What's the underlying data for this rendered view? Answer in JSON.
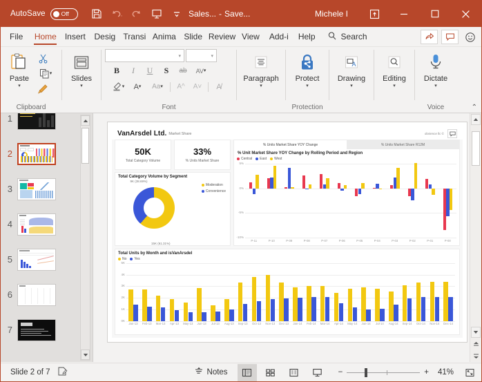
{
  "titlebar": {
    "autosave_label": "AutoSave",
    "autosave_state": "Off",
    "doc_name": "Sales...",
    "doc_sep": "-",
    "doc_saved": "Save...",
    "user": "Michele I",
    "qat": [
      "save-icon",
      "undo-icon",
      "redo-icon",
      "start-presentation-icon",
      "customize-qat-icon"
    ],
    "window_buttons": [
      "ribbon-display-options",
      "minimize",
      "maximize",
      "close"
    ],
    "bg_color": "#b7472a"
  },
  "tabs": {
    "items": [
      {
        "label": "File",
        "active": false
      },
      {
        "label": "Home",
        "active": true
      },
      {
        "label": "Insert",
        "active": false
      },
      {
        "label": "Desig",
        "active": false
      },
      {
        "label": "Transi",
        "active": false
      },
      {
        "label": "Anima",
        "active": false
      },
      {
        "label": "Slide ",
        "active": false
      },
      {
        "label": "Review",
        "active": false
      },
      {
        "label": "View",
        "active": false
      },
      {
        "label": "Add-i",
        "active": false
      },
      {
        "label": "Help",
        "active": false
      }
    ],
    "search_label": "Search",
    "right_buttons": [
      "share-icon",
      "comments-icon",
      "feedback-smiley-icon"
    ]
  },
  "ribbon": {
    "groups": [
      {
        "name": "Clipboard",
        "label": "Clipboard"
      },
      {
        "name": "Slides",
        "label": ""
      },
      {
        "name": "Font",
        "label": "Font"
      },
      {
        "name": "Paragraph",
        "label": ""
      },
      {
        "name": "Protection",
        "label": "Protection"
      },
      {
        "name": "Drawing",
        "label": ""
      },
      {
        "name": "Editing",
        "label": ""
      },
      {
        "name": "Voice",
        "label": "Voice"
      }
    ],
    "paste_label": "Paste",
    "slides_label": "Slides",
    "paragraph_label": "Paragraph",
    "protect_label": "Protect",
    "drawing_label": "Drawing",
    "editing_label": "Editing",
    "dictate_label": "Dictate",
    "font_name_value": "",
    "font_name_placeholder": "",
    "font_size_value": "",
    "font_buttons": [
      "bold",
      "italic",
      "underline",
      "text-shadow",
      "strikethrough",
      "character-spacing"
    ],
    "font_buttons_row2": [
      "text-highlight",
      "font-color",
      "change-case",
      "increase-font-size",
      "decrease-font-size",
      "clear-formatting"
    ]
  },
  "thumbnails": {
    "slides": [
      {
        "num": "1",
        "selected": false
      },
      {
        "num": "2",
        "selected": true
      },
      {
        "num": "3",
        "selected": false
      },
      {
        "num": "4",
        "selected": false
      },
      {
        "num": "5",
        "selected": false
      },
      {
        "num": "6",
        "selected": false
      },
      {
        "num": "7",
        "selected": false
      }
    ]
  },
  "slide": {
    "dashboard_title": "VanArsdel Ltd.",
    "dashboard_subtitle": "Market Share",
    "credit": "obvience llc ©",
    "kpis": [
      {
        "value": "50K",
        "label": "Total Category Volume"
      },
      {
        "value": "33%",
        "label": "% Units Market Share"
      }
    ],
    "donut_panel_title": "Total Category Volume by Segment",
    "subtabs": [
      {
        "label": "% Units Market Share YOY Change",
        "active": true
      },
      {
        "label": "% Units Market Share R12M",
        "active": false
      }
    ],
    "yoy_chart_title": "% Unit Market Share YOY Change by Rolling Period and Region",
    "bottom_panel_title": "Total Units by Month and isVanArsdel"
  },
  "chart_data": [
    {
      "type": "pie",
      "title": "Total Category Volume by Segment",
      "labels": [
        "Moderation",
        "Convenience"
      ],
      "values": [
        61.31,
        38.69
      ],
      "data_labels": [
        "15K (61.31%)",
        "9K (38.69%)"
      ],
      "colors": [
        "#f2c811",
        "#3a57d8"
      ],
      "legend": "right"
    },
    {
      "type": "bar",
      "title": "% Unit Market Share YOY Change by Rolling Period and Region",
      "xlabel": "",
      "ylabel": "",
      "ylim": [
        -10,
        5
      ],
      "ytick_labels": [
        "5%",
        "0%",
        "-5%",
        "-10%"
      ],
      "ytick_values": [
        5,
        0,
        -5,
        -10
      ],
      "grid": true,
      "legend": "top",
      "categories": [
        "P-11",
        "P-10",
        "P-09",
        "P-08",
        "P-07",
        "P-06",
        "P-05",
        "P-04",
        "P-03",
        "P-02",
        "P-01",
        "P-00"
      ],
      "series": [
        {
          "name": "Central",
          "color": "#e8384f",
          "values": [
            1.2,
            2.1,
            0.2,
            2.6,
            2.9,
            1.1,
            -1.6,
            0.05,
            0.6,
            -1.6,
            1.9,
            -8.4
          ]
        },
        {
          "name": "East",
          "color": "#3a57d8",
          "values": [
            -1.2,
            2.2,
            4.2,
            -0.1,
            0.8,
            -0.4,
            -1.1,
            0.9,
            2.2,
            -2.4,
            0.8,
            -5.6
          ]
        },
        {
          "name": "West",
          "color": "#f2c811",
          "values": [
            2.7,
            4.6,
            0.2,
            0.8,
            2.1,
            0.6,
            1.1,
            -0.1,
            4.1,
            5.2,
            -1.3,
            -4.4
          ]
        }
      ]
    },
    {
      "type": "bar",
      "title": "Total Units by Month and isVanArsdel",
      "xlabel": "",
      "ylabel": "",
      "ylim": [
        0,
        5
      ],
      "ytick_labels": [
        "5K",
        "4K",
        "3K",
        "2K",
        "1K",
        "0K"
      ],
      "ytick_values": [
        5,
        4,
        3,
        2,
        1,
        0
      ],
      "grid": true,
      "legend": "top",
      "categories": [
        "Jan-13",
        "Feb-13",
        "Mar-13",
        "Apr-13",
        "May-13",
        "Jun-13",
        "Jul-13",
        "Aug-13",
        "Sep-13",
        "Oct-13",
        "Nov-13",
        "Dec-13",
        "Jan-14",
        "Feb-14",
        "Mar-14",
        "Apr-14",
        "May-14",
        "Jun-14",
        "Jul-14",
        "Aug-14",
        "Sep-14",
        "Oct-14",
        "Nov-14",
        "Dec-14"
      ],
      "series": [
        {
          "name": "No",
          "color": "#f2c811",
          "values": [
            2.75,
            2.75,
            2.2,
            1.9,
            1.6,
            2.85,
            1.35,
            1.9,
            3.35,
            3.8,
            4.0,
            3.35,
            2.9,
            3.0,
            3.0,
            2.45,
            2.8,
            2.9,
            2.8,
            2.55,
            3.1,
            3.35,
            3.4,
            3.4
          ]
        },
        {
          "name": "Yes",
          "color": "#3a57d8",
          "values": [
            1.4,
            1.25,
            1.2,
            0.95,
            0.75,
            0.75,
            0.8,
            1.0,
            1.5,
            1.7,
            1.9,
            1.95,
            2.0,
            2.05,
            2.05,
            1.55,
            1.2,
            1.0,
            1.05,
            1.45,
            1.95,
            2.05,
            2.1,
            2.1
          ]
        }
      ]
    }
  ],
  "statusbar": {
    "slide_counter": "Slide 2 of 7",
    "notes_label": "Notes",
    "zoom_level": "41%",
    "views": [
      "normal-view",
      "slide-sorter-view",
      "reading-view",
      "slideshow-view"
    ],
    "zoom_out_label": "−",
    "zoom_in_label": "+"
  }
}
